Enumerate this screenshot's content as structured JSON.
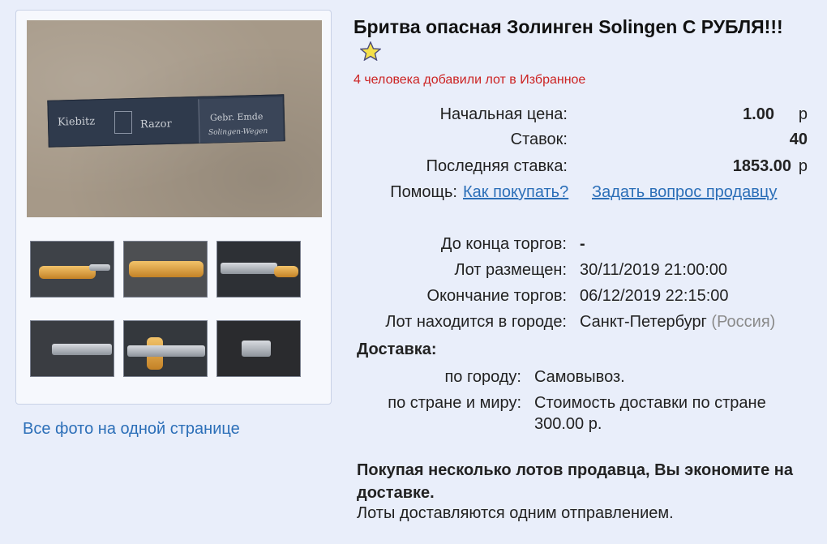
{
  "gallery": {
    "main_photo": {
      "box_text_left": "Kiebitz",
      "box_text_mid": "Razor",
      "box_text_right_1": "Gebr. Emde",
      "box_text_right_2": "Solingen-Wegen"
    },
    "thumbnails_count": 6,
    "all_photos_link": "Все фото на одной странице"
  },
  "lot": {
    "title": "Бритва опасная Золинген Solingen С РУБЛЯ!!!",
    "favorites_note": "4 человека добавили лот в Избранное"
  },
  "price": {
    "start_label": "Начальная цена:",
    "start_value": "1.00",
    "bids_label": "Ставок:",
    "bids_value": "40",
    "last_bid_label": "Последняя ставка:",
    "last_bid_value": "1853.00",
    "currency": "р"
  },
  "help": {
    "label": "Помощь:",
    "how_to_buy": "Как покупать?",
    "ask_seller": "Задать вопрос продавцу"
  },
  "auction": {
    "ends_in_label": "До конца торгов:",
    "ends_in_value": "-",
    "posted_label": "Лот размещен:",
    "posted_value": "30/11/2019 21:00:00",
    "end_label": "Окончание торгов:",
    "end_value": "06/12/2019 22:15:00",
    "city_label": "Лот находится в городе:",
    "city_value": "Санкт-Петербург",
    "country_value": "(Россия)"
  },
  "delivery": {
    "heading": "Доставка:",
    "city_label": "по городу:",
    "city_value": "Самовывоз.",
    "country_label": "по стране и миру:",
    "country_value_line1": "Стоимость доставки по стране",
    "country_value_line2": "300.00 р."
  },
  "promo": {
    "bold_text": "Покупая несколько лотов продавца, Вы экономите на доставке.",
    "text": "Лоты доставляются одним отправлением."
  },
  "colors": {
    "background": "#e9eefa",
    "link": "#2c6fb8",
    "favorites_red": "#cc2222"
  }
}
